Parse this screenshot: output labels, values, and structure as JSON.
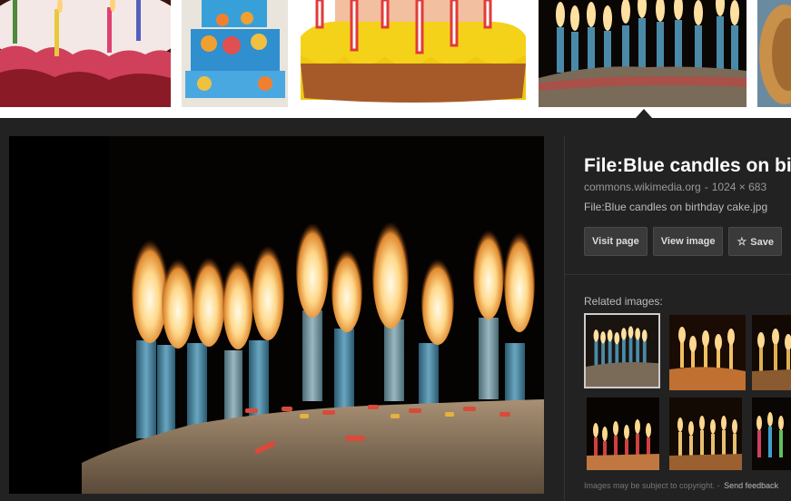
{
  "preview": {
    "title": "File:Blue candles on birthday cake.jpg",
    "source": "commons.wikimedia.org",
    "separator": "-",
    "dimensions": "1024 × 683",
    "filename": "File:Blue candles on birthday cake.jpg"
  },
  "buttons": {
    "visit_page": "Visit page",
    "view_image": "View image",
    "save": "Save"
  },
  "related": {
    "label": "Related images:"
  },
  "footer": {
    "notice": "Images may be subject to copyright.",
    "separator": "-",
    "feedback": "Send feedback"
  },
  "icons": {
    "save": "star-icon"
  },
  "colors": {
    "panel_bg": "#222222",
    "button_bg": "#3a3a3a",
    "title_text": "#ffffff",
    "muted_text": "#999999"
  }
}
